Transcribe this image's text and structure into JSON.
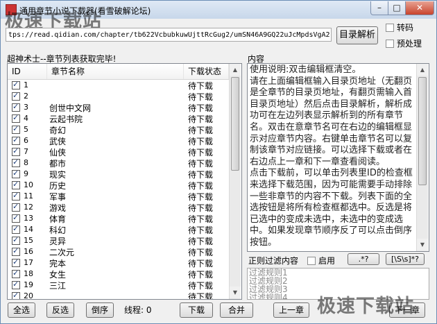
{
  "window": {
    "title": "通用章节小说下载器(看雪破解论坛)",
    "watermark": "极速下载站",
    "min_label": "–",
    "max_label": "□",
    "close_label": "✕"
  },
  "toolbar": {
    "url_value": "tps://read.qidian.com/chapter/tb622VcbubkuwUjttRcGug2/umSN46A9GQ22uJcMpdsVgA2",
    "parse_button": "目录解析",
    "transcode_label": "转码",
    "transcode_checked": false,
    "preprocess_label": "预处理",
    "preprocess_checked": false
  },
  "chapter_list": {
    "status_text": "超神术士--章节列表获取完毕!",
    "columns": [
      "ID",
      "章节名称",
      "下载状态"
    ],
    "rows": [
      {
        "id": "1",
        "name": "",
        "status": "待下载"
      },
      {
        "id": "2",
        "name": "",
        "status": "待下载"
      },
      {
        "id": "3",
        "name": "创世中文网",
        "status": "待下载"
      },
      {
        "id": "4",
        "name": "云起书院",
        "status": "待下载"
      },
      {
        "id": "5",
        "name": "奇幻",
        "status": "待下载"
      },
      {
        "id": "6",
        "name": "武侠",
        "status": "待下载"
      },
      {
        "id": "7",
        "name": "仙侠",
        "status": "待下载"
      },
      {
        "id": "8",
        "name": "都市",
        "status": "待下载"
      },
      {
        "id": "9",
        "name": "现实",
        "status": "待下载"
      },
      {
        "id": "10",
        "name": "历史",
        "status": "待下载"
      },
      {
        "id": "11",
        "name": "军事",
        "status": "待下载"
      },
      {
        "id": "12",
        "name": "游戏",
        "status": "待下载"
      },
      {
        "id": "13",
        "name": "体育",
        "status": "待下载"
      },
      {
        "id": "14",
        "name": "科幻",
        "status": "待下载"
      },
      {
        "id": "15",
        "name": "灵异",
        "status": "待下载"
      },
      {
        "id": "16",
        "name": "二次元",
        "status": "待下载"
      },
      {
        "id": "17",
        "name": "完本",
        "status": "待下载"
      },
      {
        "id": "18",
        "name": "女生",
        "status": "待下载"
      },
      {
        "id": "19",
        "name": "三江",
        "status": "待下载"
      },
      {
        "id": "20",
        "name": "",
        "status": "待下载"
      }
    ]
  },
  "content_panel": {
    "label": "内容",
    "text": "使用说明:双击编辑框清空。\n请在上面编辑框输入目录页地址（无翻页是全章节的目录页地址，有翻页需输入首目录页地址）然后点击目录解析，解析成功可在左边列表显示解析到的所有章节名。双击在意章节名可在右边的编辑框显示对应章节内容。右键单击章节名可以复制该章节对应链接。可以选择下载或者在右边点上一章和下一章查看阅读。\n点击下载前，可以单击列表里ID的检查框来选择下载范围，因为可能需要手动排除一些非章节的内容不下载。列表下面的全选按钮是将所有检查框都选中。反选是将已选中的变成未选中，未选中的变成选中。如果发现章节顺序反了可以点击倒序按钮。"
  },
  "filter": {
    "label": "正则过滤内容",
    "enable_label": "启用",
    "enable_checked": false,
    "regex_button_1": ".*?",
    "regex_button_2": "[\\S\\s]*?",
    "rules": [
      "过滤规则1",
      "过滤规则2",
      "过滤规则3",
      "过滤规则4"
    ]
  },
  "bottom_bar": {
    "select_all": "全选",
    "invert": "反选",
    "reverse": "倒序",
    "thread_label": "线程: 0",
    "download": "下载",
    "merge": "合并",
    "prev_chapter": "上一章",
    "next_chapter": "下一章"
  }
}
